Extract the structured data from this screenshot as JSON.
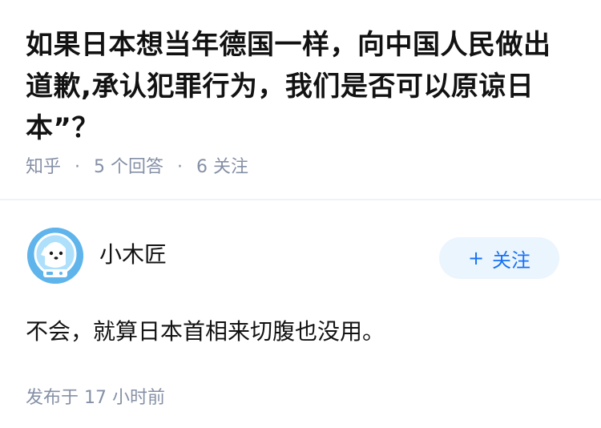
{
  "question": {
    "title": "如果日本想当年德国一样，向中国人民做出道歉,承认犯罪行为，我们是否可以原谅日本”？",
    "source": "知乎",
    "answers_count": "5 个回答",
    "followers_count": "6 关注",
    "separator": "·"
  },
  "answer": {
    "author_name": "小木匠",
    "follow_label": "关注",
    "follow_icon": "+",
    "content": "不会，就算日本首相来切腹也没用。",
    "time": "发布于 17 小时前"
  },
  "colors": {
    "meta_text": "#8590a6",
    "accent_blue": "#1772f6",
    "follow_bg": "#ebf5fd",
    "avatar_bg": "#5fb4ec"
  }
}
